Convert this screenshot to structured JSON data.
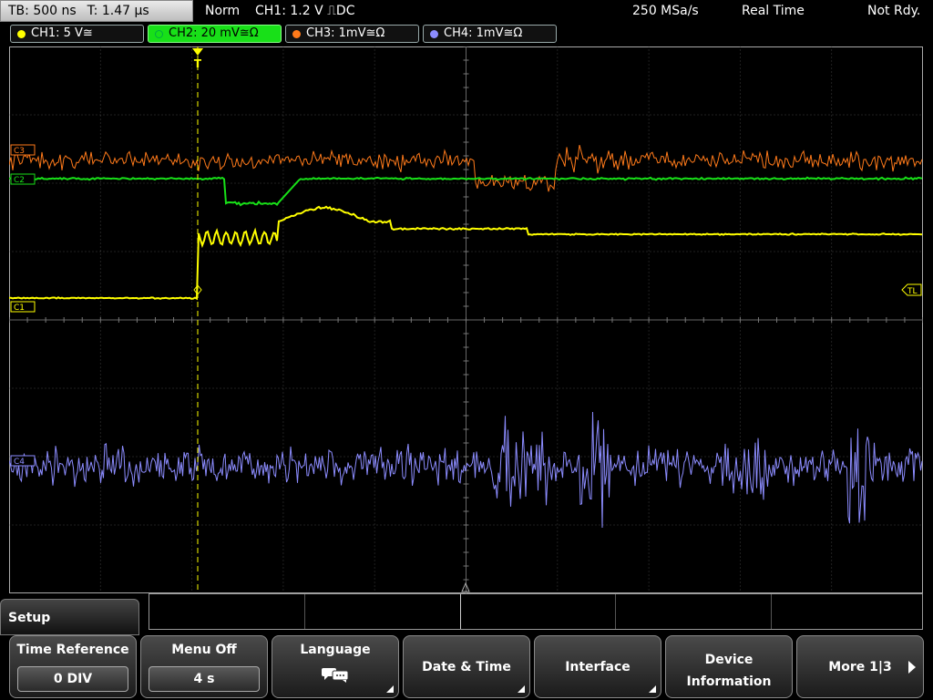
{
  "status": {
    "timebase": "TB: 500 ns",
    "trigger_time": "T: 1.47 µs",
    "mode": "Norm",
    "trigger": "CH1: 1.2 V ⎍DC",
    "sample_rate": "250 MSa/s",
    "acquisition": "Real Time",
    "state": "Not Rdy."
  },
  "channels": [
    {
      "label": "CH1: 5 V≅",
      "color": "#ffff00",
      "active": false
    },
    {
      "label": "CH2: 20 mV≅Ω",
      "color": "#18e018",
      "active": true
    },
    {
      "label": "CH3: 1mV≅Ω",
      "color": "#ff7a1a",
      "active": false
    },
    {
      "label": "CH4: 1mV≅Ω",
      "color": "#8c8cff",
      "active": false
    }
  ],
  "markers": {
    "c1": "C1",
    "c2": "C2",
    "c3": "C3",
    "c4": "C4",
    "trigger_level": "TL",
    "trigger_pos": "T"
  },
  "setup": {
    "title": "Setup"
  },
  "softkeys": [
    {
      "label": "Time Reference",
      "value": "0 DIV"
    },
    {
      "label": "Menu Off",
      "value": "4 s"
    },
    {
      "label": "Language",
      "icon": "speech-bubbles"
    },
    {
      "label": "Date & Time"
    },
    {
      "label": "Interface"
    },
    {
      "label_line1": "Device",
      "label_line2": "Information"
    },
    {
      "label": "More 1|3"
    }
  ]
}
